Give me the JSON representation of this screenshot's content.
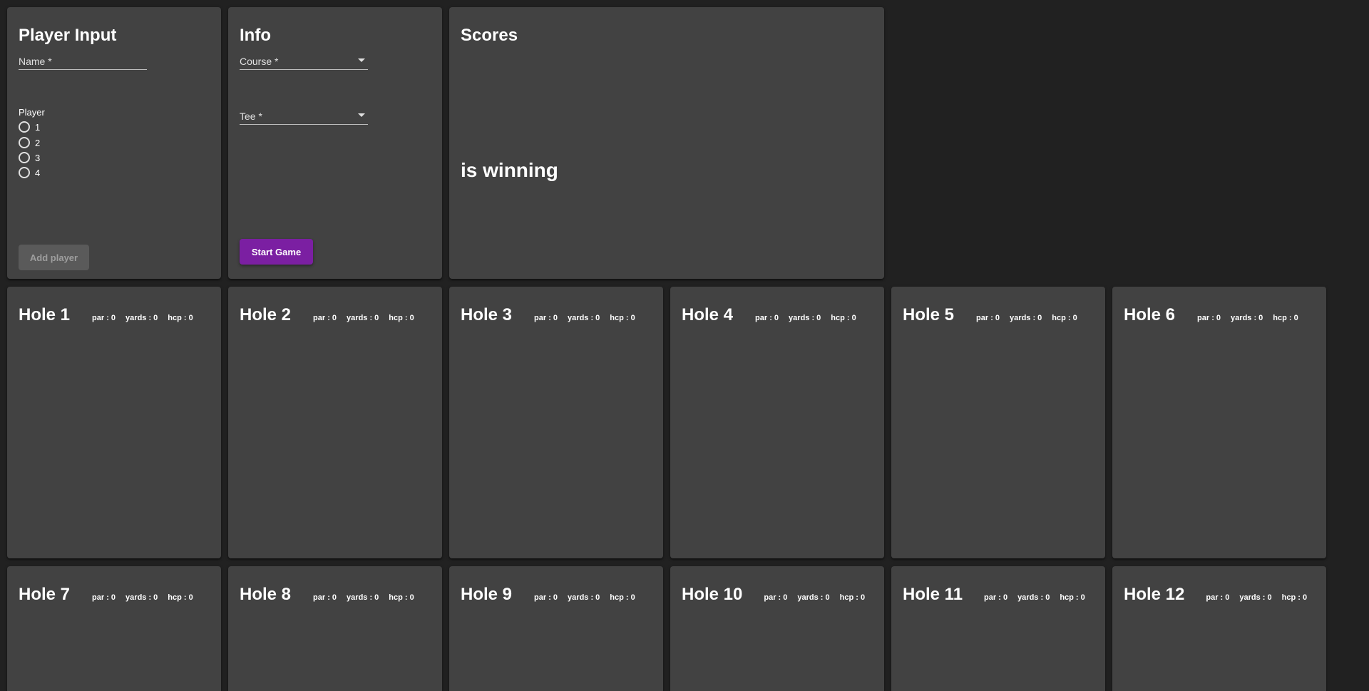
{
  "player_input": {
    "title": "Player Input",
    "name_label": "Name *",
    "player_label": "Player",
    "player_options": [
      "1",
      "2",
      "3",
      "4"
    ],
    "add_button": "Add player"
  },
  "info": {
    "title": "Info",
    "course_label": "Course *",
    "tee_label": "Tee *",
    "start_button": "Start Game"
  },
  "scores": {
    "title": "Scores",
    "winning_text": "is winning"
  },
  "holes": [
    {
      "title": "Hole 1",
      "par": "par : 0",
      "yards": "yards : 0",
      "hcp": "hcp : 0"
    },
    {
      "title": "Hole 2",
      "par": "par : 0",
      "yards": "yards : 0",
      "hcp": "hcp : 0"
    },
    {
      "title": "Hole 3",
      "par": "par : 0",
      "yards": "yards : 0",
      "hcp": "hcp : 0"
    },
    {
      "title": "Hole 4",
      "par": "par : 0",
      "yards": "yards : 0",
      "hcp": "hcp : 0"
    },
    {
      "title": "Hole 5",
      "par": "par : 0",
      "yards": "yards : 0",
      "hcp": "hcp : 0"
    },
    {
      "title": "Hole 6",
      "par": "par : 0",
      "yards": "yards : 0",
      "hcp": "hcp : 0"
    },
    {
      "title": "Hole 7",
      "par": "par : 0",
      "yards": "yards : 0",
      "hcp": "hcp : 0"
    },
    {
      "title": "Hole 8",
      "par": "par : 0",
      "yards": "yards : 0",
      "hcp": "hcp : 0"
    },
    {
      "title": "Hole 9",
      "par": "par : 0",
      "yards": "yards : 0",
      "hcp": "hcp : 0"
    },
    {
      "title": "Hole 10",
      "par": "par : 0",
      "yards": "yards : 0",
      "hcp": "hcp : 0"
    },
    {
      "title": "Hole 11",
      "par": "par : 0",
      "yards": "yards : 0",
      "hcp": "hcp : 0"
    },
    {
      "title": "Hole 12",
      "par": "par : 0",
      "yards": "yards : 0",
      "hcp": "hcp : 0"
    }
  ],
  "colors": {
    "background": "#212121",
    "card": "#424242",
    "primary_button": "#7b1fa2",
    "disabled_button": "#5a5a5a"
  }
}
